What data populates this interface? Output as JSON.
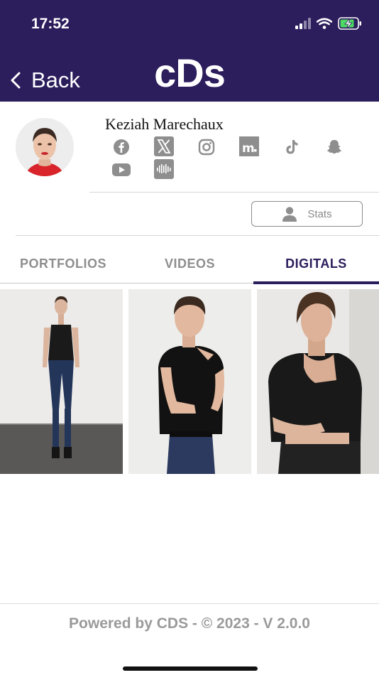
{
  "status_bar": {
    "time": "17:52"
  },
  "header": {
    "back_label": "Back",
    "brand": "cDs"
  },
  "profile": {
    "name": "Keziah Marechaux",
    "social_icons": [
      "facebook-icon",
      "x-twitter-icon",
      "instagram-icon",
      "models-com-icon",
      "tiktok-icon",
      "snapchat-icon",
      "youtube-icon",
      "soundcloud-icon"
    ],
    "stats_label": "Stats"
  },
  "tabs": [
    {
      "label": "PORTFOLIOS",
      "active": false
    },
    {
      "label": "VIDEOS",
      "active": false
    },
    {
      "label": "DIGITALS",
      "active": true
    }
  ],
  "photos": [
    "digital-photo-full-length",
    "digital-photo-half-length",
    "digital-photo-close-up"
  ],
  "footer": {
    "text": "Powered by CDS - © 2023 - V 2.0.0"
  },
  "colors": {
    "header_bg": "#2c1d5c",
    "accent": "#2c1d5c",
    "muted": "#8e8e8e"
  }
}
